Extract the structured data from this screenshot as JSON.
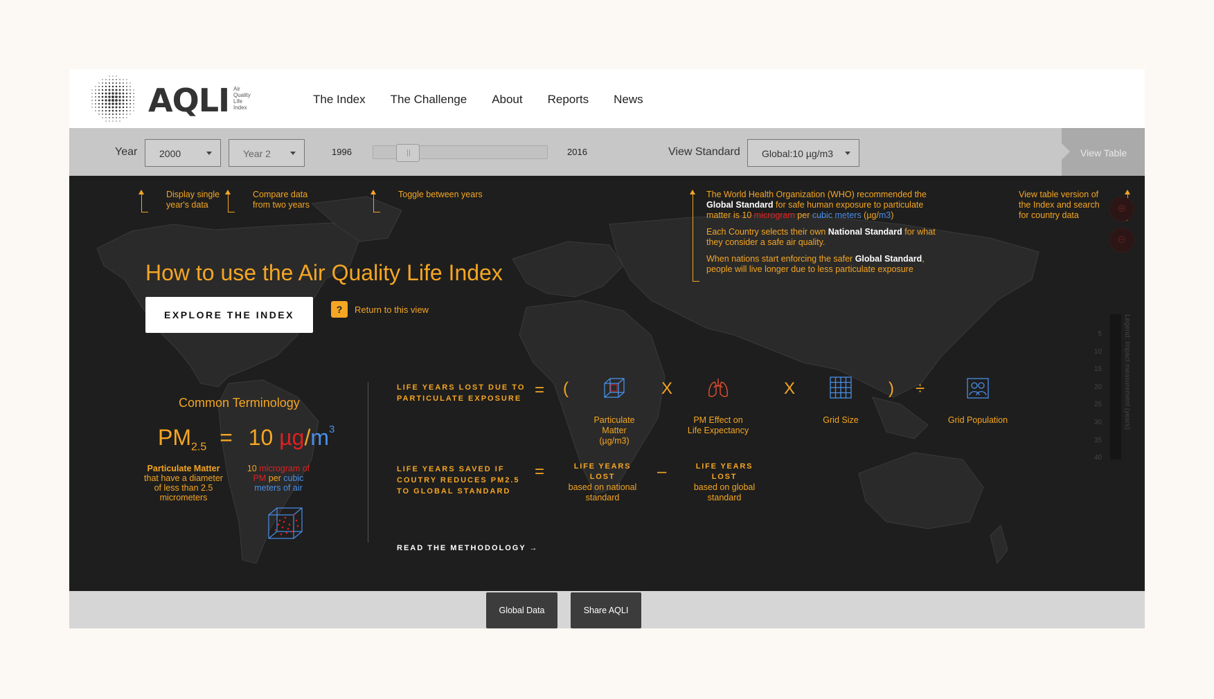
{
  "logo": {
    "word": "AQLI",
    "sub": [
      "Air",
      "Quality",
      "Life",
      "Index"
    ]
  },
  "nav": [
    "The Index",
    "The Challenge",
    "About",
    "Reports",
    "News"
  ],
  "controls": {
    "year_label": "Year",
    "year_value": "2000",
    "year2_value": "Year 2",
    "slider_start": "1996",
    "slider_end": "2016",
    "standard_label": "View Standard",
    "standard_value": "Global:10 µg/m3",
    "view_table": "View Table"
  },
  "tips": {
    "single_1": "Display single",
    "single_2": "year's data",
    "compare_1": "Compare data",
    "compare_2": "from two years",
    "toggle": "Toggle between years",
    "who_a1": "The World Health Organization (WHO) recommended the",
    "who_a2_b": "Global Standard",
    "who_a2": " for safe human exposure to particulate",
    "who_a3": "matter is 10 ",
    "who_a3_red": "microgram",
    "who_a3_mid": " per ",
    "who_a3_blue": "cubic meters",
    "who_a3_end1": " (µg/",
    "who_a3_blue2": "m3",
    "who_a3_end2": ")",
    "who_b1": "Each Country selects their own ",
    "who_b1_b": "National Standard",
    "who_b1_end": " for what",
    "who_b2": "they consider a safe air quality.",
    "who_c1": "When nations start enforcing the safer ",
    "who_c1_b": "Global Standard",
    "who_c1_end": ",",
    "who_c2": "people will live longer due to less particulate exposure",
    "table_1": "View table version of",
    "table_2": "the Index and search",
    "table_3": "for country data"
  },
  "intro": {
    "headline": "How to use the Air Quality Life Index",
    "explore_button": "EXPLORE THE INDEX",
    "help_badge": "?",
    "help_text": "Return to this view"
  },
  "terminology": {
    "title": "Common Terminology",
    "pm": "PM",
    "pm_sub": "2.5",
    "equals": "=",
    "ten": "10",
    "ug": "µg",
    "slash": "/",
    "m": "m",
    "cube": "3",
    "def_pm_bold": "Particulate Matter",
    "def_pm_1": "that have a diameter",
    "def_pm_2": "of less than 2.5",
    "def_pm_3": "micrometers",
    "def_unit_1a": "10 ",
    "def_unit_1b": "microgram of",
    "def_unit_2a": "PM",
    "def_unit_2b": " per ",
    "def_unit_2c": "cubic",
    "def_unit_3": "meters of air"
  },
  "formula": {
    "lost_1": "LIFE YEARS LOST DUE TO",
    "lost_2": "PARTICULATE EXPOSURE",
    "eq": "=",
    "open": "(",
    "times": "X",
    "close": ")",
    "divide": "÷",
    "minus": "–",
    "pm_1": "Particulate",
    "pm_2": "Matter",
    "pm_3": "(µg/m3)",
    "effect_1": "PM Effect on",
    "effect_2": "Life Expectancy",
    "grid_size": "Grid Size",
    "grid_pop": "Grid Population",
    "saved_1": "LIFE YEARS SAVED IF",
    "saved_2": "COUTRY REDUCES PM2.5",
    "saved_3": "TO GLOBAL STANDARD",
    "national_t": "LIFE YEARS LOST",
    "national_1": "based on national",
    "national_2": "standard",
    "global_t": "LIFE YEARS LOST",
    "global_1": "based on global",
    "global_2": "standard",
    "methodology": "READ THE METHODOLOGY →"
  },
  "legend": {
    "title": "Legend: Impact measurement (years)",
    "values": [
      "5",
      "10",
      "15",
      "20",
      "25",
      "30",
      "35",
      "40"
    ]
  },
  "footer": {
    "global_data": "Global Data",
    "share": "Share AQLI"
  },
  "colors": {
    "orange": "#f5a623",
    "red": "#e02020",
    "blue": "#4a8fe8",
    "dark": "#1e1e1e"
  }
}
